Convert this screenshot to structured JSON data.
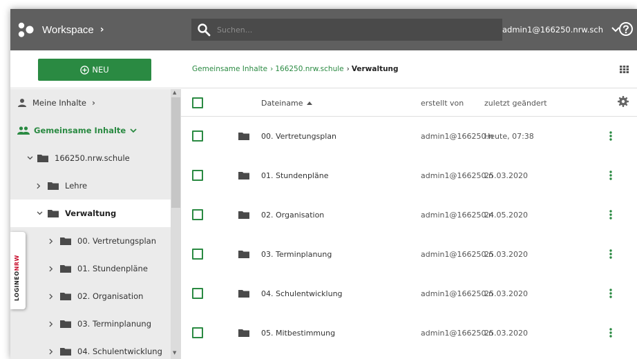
{
  "header": {
    "app_title": "Workspace",
    "search_placeholder": "Suchen...",
    "user": "admin1@166250.nrw.sch"
  },
  "toolbar": {
    "new_label": "NEU"
  },
  "breadcrumb": {
    "items": [
      "Gemeinsame Inhalte",
      "166250.nrw.schule"
    ],
    "current": "Verwaltung"
  },
  "sidebar": {
    "my_content": "Meine Inhalte",
    "shared_content": "Gemeinsame Inhalte",
    "tree": [
      {
        "label": "166250.nrw.schule"
      },
      {
        "label": "Lehre"
      },
      {
        "label": "Verwaltung"
      },
      {
        "label": "00. Vertretungsplan"
      },
      {
        "label": "01. Stundenpläne"
      },
      {
        "label": "02. Organisation"
      },
      {
        "label": "03. Terminplanung"
      },
      {
        "label": "04. Schulentwicklung"
      }
    ]
  },
  "logineo": {
    "part1": "LOGINEO",
    "part2": "NRW"
  },
  "table": {
    "columns": {
      "name": "Dateiname",
      "creator": "erstellt von",
      "modified": "zuletzt geändert"
    },
    "rows": [
      {
        "name": "00. Vertretungsplan",
        "creator": "admin1@166250.n",
        "modified": "Heute, 07:38"
      },
      {
        "name": "01. Stundenpläne",
        "creator": "admin1@166250.n",
        "modified": "25.03.2020"
      },
      {
        "name": "02. Organisation",
        "creator": "admin1@166250.n",
        "modified": "24.05.2020"
      },
      {
        "name": "03. Terminplanung",
        "creator": "admin1@166250.n",
        "modified": "25.03.2020"
      },
      {
        "name": "04. Schulentwicklung",
        "creator": "admin1@166250.n",
        "modified": "25.03.2020"
      },
      {
        "name": "05. Mitbestimmung",
        "creator": "admin1@166250.n",
        "modified": "25.03.2020"
      }
    ]
  },
  "colors": {
    "accent": "#2a8a42",
    "header_bg": "#5f5f5f",
    "sidebar_bg": "#ebebeb"
  },
  "icons": [
    "workspace-logo-icon",
    "search-icon",
    "chevron-down-icon",
    "help-icon",
    "plus-circle-icon",
    "grid-view-icon",
    "user-icon",
    "group-icon",
    "folder-icon",
    "gear-icon",
    "sort-asc-icon",
    "kebab-menu-icon"
  ]
}
